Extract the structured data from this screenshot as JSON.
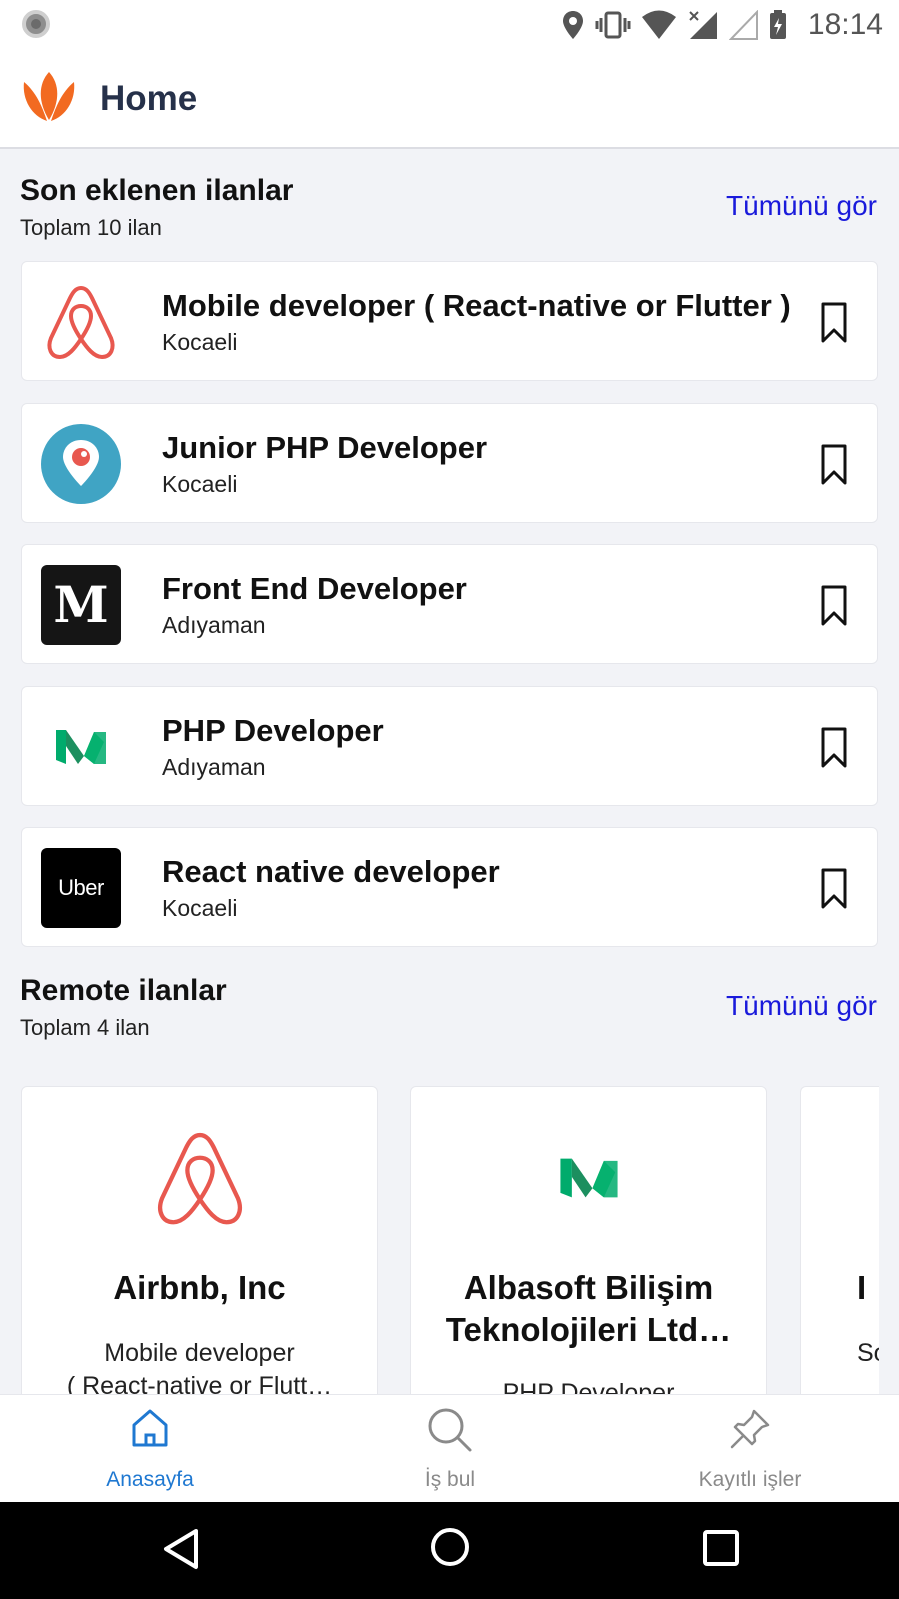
{
  "status_bar": {
    "time": "18:14"
  },
  "app_bar": {
    "title": "Home"
  },
  "recent": {
    "title": "Son eklenen ilanlar",
    "subtitle": "Toplam 10 ilan",
    "see_all": "Tümünü gör",
    "jobs": [
      {
        "title": "Mobile developer ( React-native or Flutter )",
        "city": "Kocaeli",
        "logo": "airbnb-logo"
      },
      {
        "title": "Junior PHP Developer",
        "city": "Kocaeli",
        "logo": "periscope-logo"
      },
      {
        "title": "Front End Developer",
        "city": "Adıyaman",
        "logo": "medium-m-logo"
      },
      {
        "title": "PHP Developer",
        "city": "Adıyaman",
        "logo": "medium-green-logo"
      },
      {
        "title": "React native developer",
        "city": "Kocaeli",
        "logo": "uber-logo"
      }
    ]
  },
  "remote": {
    "title": "Remote ilanlar",
    "subtitle": "Toplam 4 ilan",
    "see_all": "Tümünü gör",
    "cards": [
      {
        "company": "Airbnb, Inc",
        "position_line1": "Mobile developer",
        "position_line2": "( React-native or Flutt…",
        "logo": "airbnb-logo"
      },
      {
        "company_line1": "Albasoft Bilişim",
        "company_line2": "Teknolojileri Ltd…",
        "position_line1": "PHP Developer",
        "logo": "medium-green-logo"
      },
      {
        "company_partial": "I",
        "position_partial": "So"
      }
    ]
  },
  "logo_texts": {
    "uber": "Uber",
    "medium": "M"
  },
  "bottom_nav": [
    {
      "label": "Anasayfa",
      "icon": "home-icon",
      "active": true
    },
    {
      "label": "İş bul",
      "icon": "search-icon",
      "active": false
    },
    {
      "label": "Kayıtlı işler",
      "icon": "pin-icon",
      "active": false
    }
  ],
  "colors": {
    "brand_orange": "#f26a21",
    "link_blue": "#1a1adb",
    "nav_active": "#1f78d1",
    "airbnb_red": "#e8584f",
    "periscope_blue": "#40a4c4",
    "medium_green": "#00ab6c"
  }
}
